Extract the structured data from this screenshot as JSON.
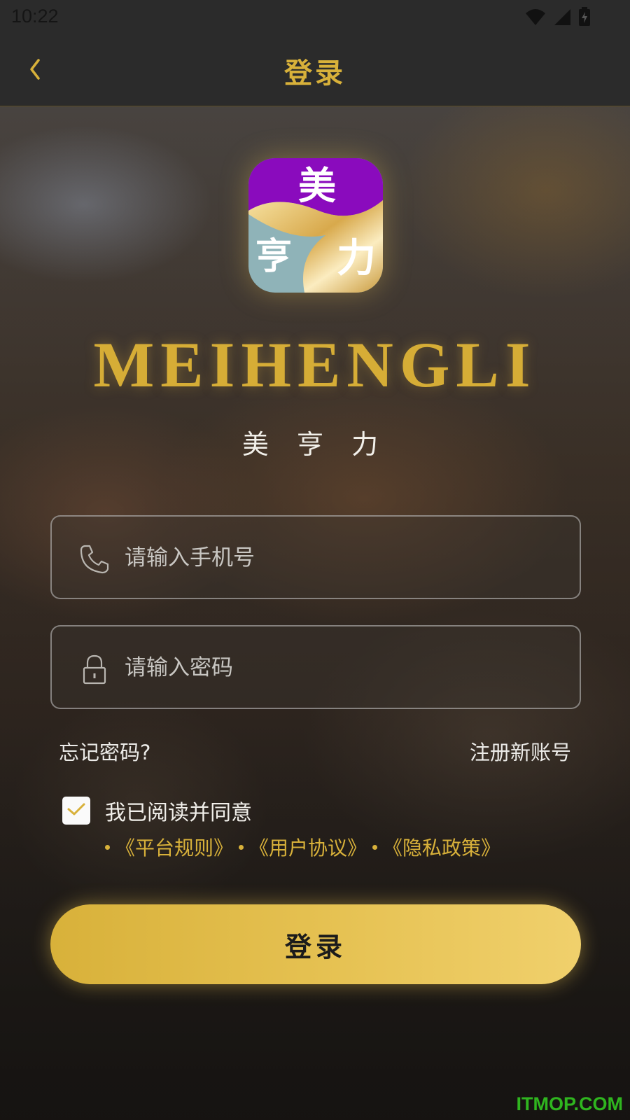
{
  "status_bar": {
    "time": "10:22"
  },
  "nav": {
    "title": "登录"
  },
  "brand": {
    "logo_chars": {
      "top": "美",
      "left": "亨",
      "right": "力"
    },
    "name": "MEIHENGLI",
    "subtitle": "美 亨 力"
  },
  "form": {
    "phone_placeholder": "请输入手机号",
    "password_placeholder": "请输入密码",
    "forgot_label": "忘记密码?",
    "register_label": "注册新账号",
    "agree_checked": true,
    "agree_label": "我已阅读并同意",
    "policies": [
      "《平台规则》",
      "《用户协议》",
      "《隐私政策》"
    ],
    "login_label": "登录"
  },
  "watermark": "ITMOP.COM",
  "colors": {
    "accent_gold": "#d8b13a",
    "bar_bg": "#2b2b2b",
    "logo_purple": "#8a0bbd",
    "logo_teal": "#8fb3b8",
    "watermark_green": "#2fb51f"
  },
  "icons": {
    "back": "chevron-left-icon",
    "wifi": "wifi-icon",
    "signal": "signal-icon",
    "battery": "battery-icon",
    "phone": "phone-icon",
    "lock": "lock-icon",
    "check": "check-icon"
  }
}
